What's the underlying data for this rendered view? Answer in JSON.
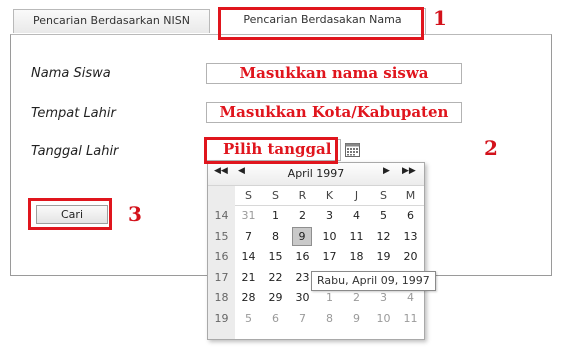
{
  "tabs": [
    {
      "label": "Pencarian Berdasarkan NISN"
    },
    {
      "label": "Pencarian Berdasakan Nama"
    }
  ],
  "form": {
    "nama_label": "Nama Siswa",
    "nama_value": "Masukkan nama siswa",
    "tempat_label": "Tempat Lahir",
    "tempat_value": "Masukkan Kota/Kabupaten",
    "tanggal_label": "Tanggal Lahir",
    "tanggal_value": "Pilih tanggal",
    "cari_label": "Cari"
  },
  "annotations": {
    "one": "1",
    "two": "2",
    "three": "3"
  },
  "calendar": {
    "title": "April 1997",
    "nav": {
      "prev_year": "◀◀",
      "prev_month": "◀",
      "next_month": "▶",
      "next_year": "▶▶"
    },
    "day_headers": [
      "S",
      "S",
      "R",
      "K",
      "J",
      "S",
      "M"
    ],
    "weeks": [
      {
        "week": "14",
        "days": [
          "31",
          "1",
          "2",
          "3",
          "4",
          "5",
          "6"
        ],
        "other": [
          true,
          false,
          false,
          false,
          false,
          false,
          false
        ]
      },
      {
        "week": "15",
        "days": [
          "7",
          "8",
          "9",
          "10",
          "11",
          "12",
          "13"
        ],
        "other": [
          false,
          false,
          false,
          false,
          false,
          false,
          false
        ]
      },
      {
        "week": "16",
        "days": [
          "14",
          "15",
          "16",
          "17",
          "18",
          "19",
          "20"
        ],
        "other": [
          false,
          false,
          false,
          false,
          false,
          false,
          false
        ]
      },
      {
        "week": "17",
        "days": [
          "21",
          "22",
          "23",
          "24",
          "25",
          "26",
          "27"
        ],
        "other": [
          false,
          false,
          false,
          false,
          false,
          false,
          false
        ]
      },
      {
        "week": "18",
        "days": [
          "28",
          "29",
          "30",
          "1",
          "2",
          "3",
          "4"
        ],
        "other": [
          false,
          false,
          false,
          true,
          true,
          true,
          true
        ]
      },
      {
        "week": "19",
        "days": [
          "5",
          "6",
          "7",
          "8",
          "9",
          "10",
          "11"
        ],
        "other": [
          true,
          true,
          true,
          true,
          true,
          true,
          true
        ]
      }
    ],
    "selected": "9",
    "tooltip": "Rabu, April 09, 1997"
  },
  "colors": {
    "accent_red": "#e0151d",
    "calendar_week_bg": "#ececec"
  }
}
